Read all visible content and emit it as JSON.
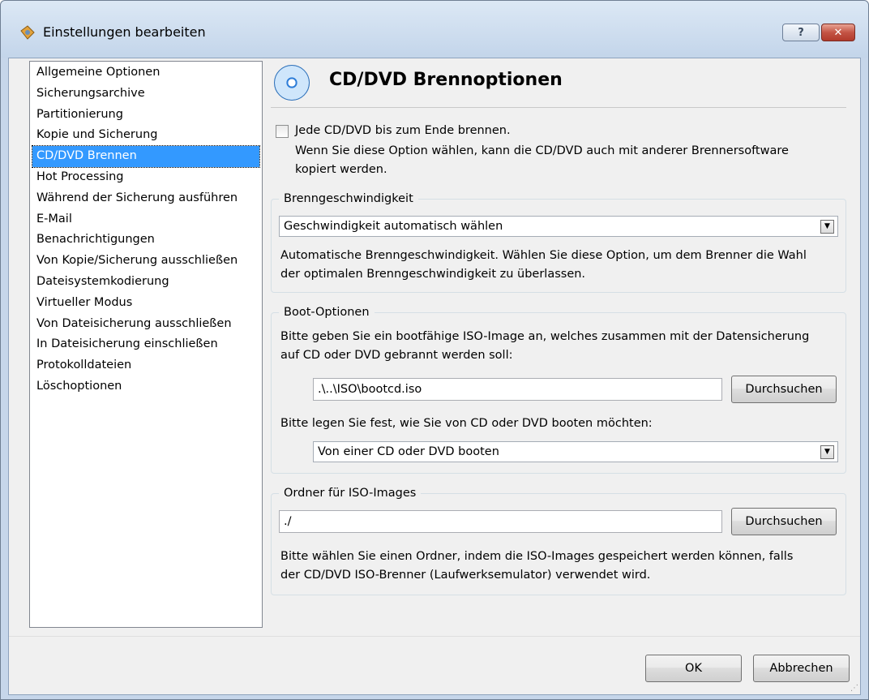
{
  "window": {
    "title": "Einstellungen bearbeiten",
    "help_label": "?",
    "close_label": "✕"
  },
  "sidebar": {
    "items": [
      {
        "label": "Allgemeine Optionen"
      },
      {
        "label": "Sicherungsarchive"
      },
      {
        "label": "Partitionierung"
      },
      {
        "label": "Kopie und Sicherung"
      },
      {
        "label": "CD/DVD Brennen",
        "selected": true
      },
      {
        "label": "Hot Processing"
      },
      {
        "label": "Während der Sicherung ausführen"
      },
      {
        "label": "E-Mail"
      },
      {
        "label": "Benachrichtigungen"
      },
      {
        "label": "Von Kopie/Sicherung ausschließen"
      },
      {
        "label": "Dateisystemkodierung"
      },
      {
        "label": "Virtueller Modus"
      },
      {
        "label": "Von Dateisicherung ausschließen"
      },
      {
        "label": "In Dateisicherung einschließen"
      },
      {
        "label": "Protokolldateien"
      },
      {
        "label": "Löschoptionen"
      }
    ]
  },
  "page": {
    "icon": "cd-dvd-icon",
    "title": "CD/DVD Brennoptionen",
    "burn_to_end": {
      "checked": false,
      "label": "Jede CD/DVD bis zum Ende brennen.",
      "description_1": "Wenn Sie diese Option wählen, kann die CD/DVD auch mit anderer Brennersoftware",
      "description_2": "kopiert werden."
    },
    "speed": {
      "legend": "Brenngeschwindigkeit",
      "selected": "Geschwindigkeit automatisch wählen",
      "description_1": "Automatische Brenngeschwindigkeit. Wählen Sie diese Option, um dem Brenner die Wahl",
      "description_2": "der optimalen Brenngeschwindigkeit zu überlassen."
    },
    "boot": {
      "legend": "Boot-Optionen",
      "description_1": "Bitte geben Sie ein bootfähige ISO-Image an, welches zusammen mit der Datensicherung",
      "description_2": "auf CD oder DVD gebrannt werden soll:",
      "iso_path": ".\\..\\ISO\\bootcd.iso",
      "browse_label": "Durchsuchen",
      "mode_prompt": "Bitte legen Sie fest, wie Sie von CD oder DVD booten möchten:",
      "mode_selected": "Von einer CD oder DVD booten"
    },
    "iso_folder": {
      "legend": "Ordner für ISO-Images",
      "path": "./",
      "browse_label": "Durchsuchen",
      "description_1": "Bitte wählen Sie einen Ordner, indem die ISO-Images gespeichert werden können, falls",
      "description_2": "der CD/DVD ISO-Brenner (Laufwerksemulator) verwendet wird."
    }
  },
  "footer": {
    "ok_label": "OK",
    "cancel_label": "Abbrechen"
  }
}
